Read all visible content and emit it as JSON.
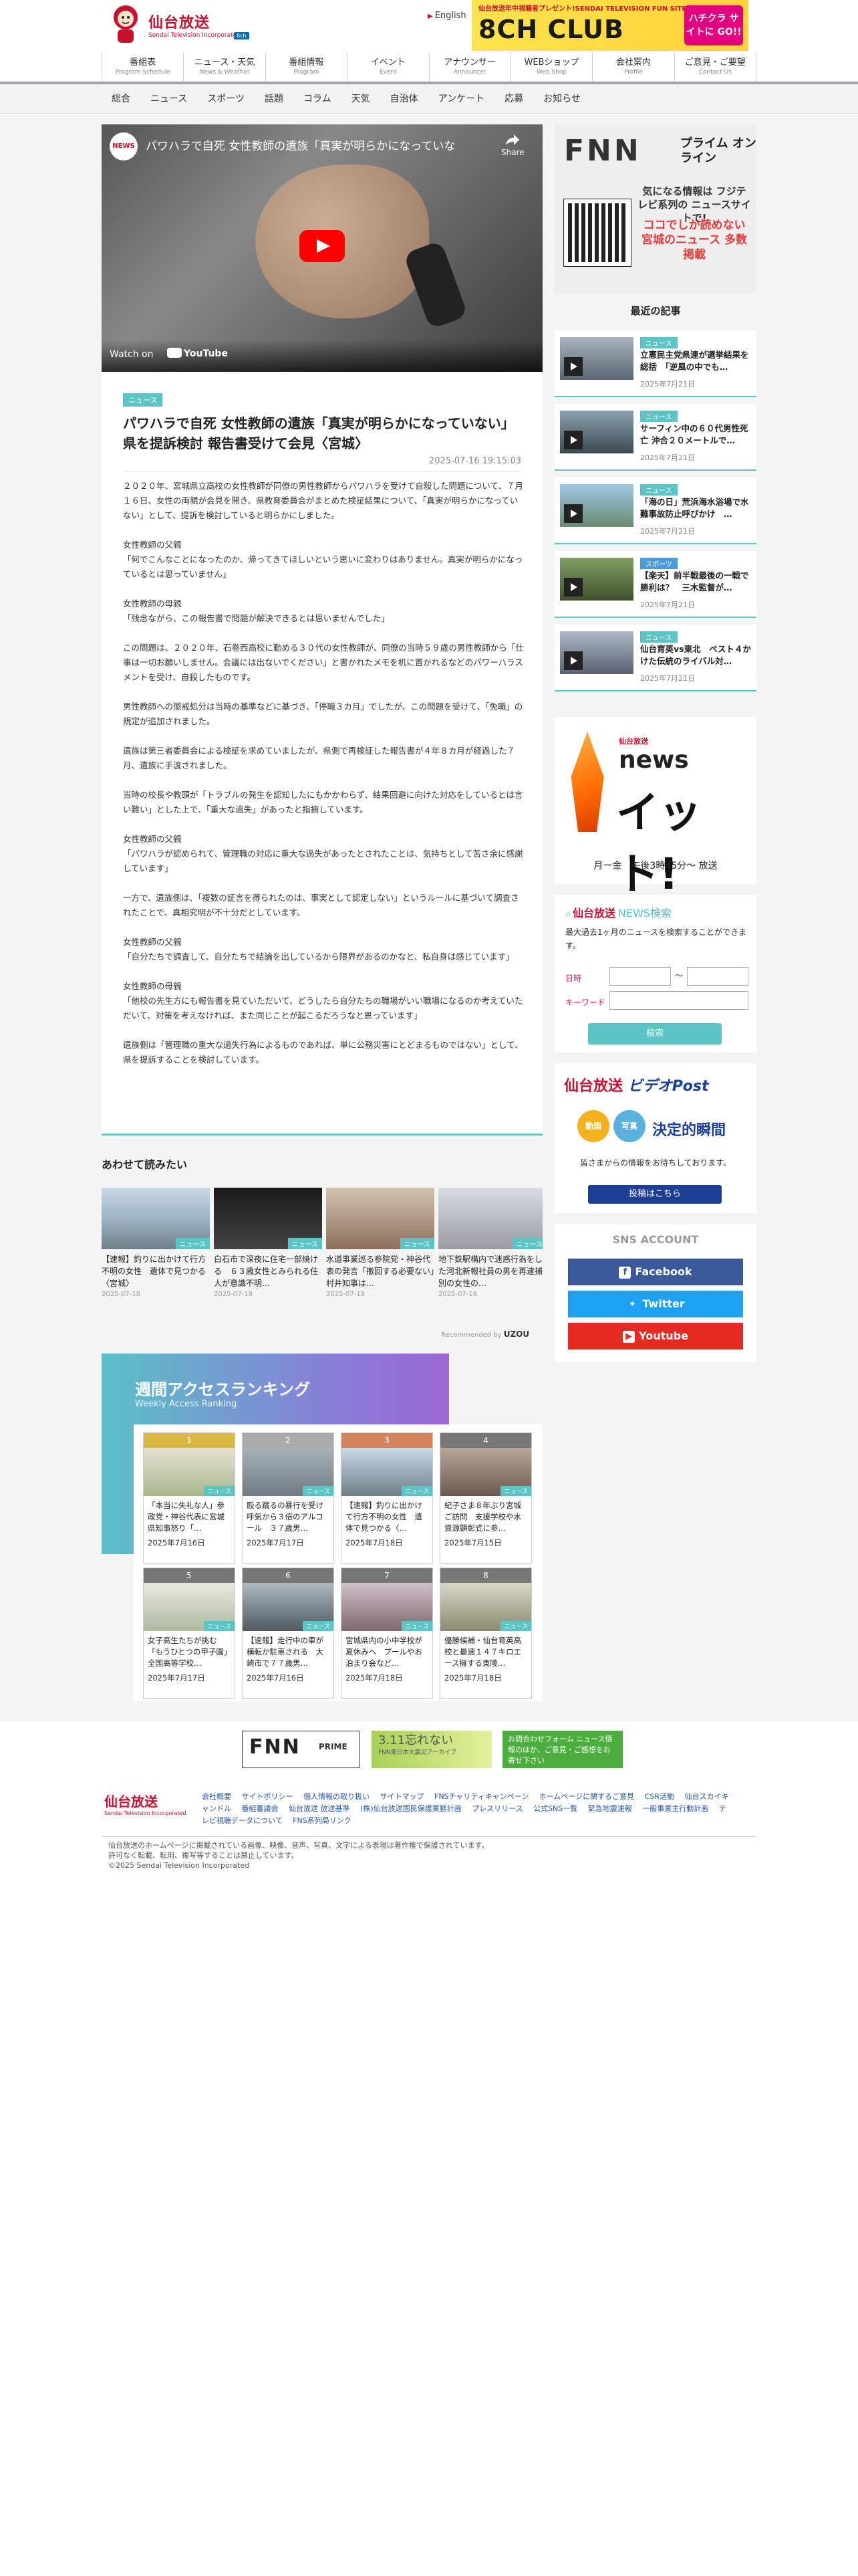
{
  "header": {
    "logo_text": "仙台放送",
    "logo_sub": "Sendai Television Incorporated",
    "logo_badge": "8ch",
    "lang": "English",
    "banner": {
      "top": "仙台放送年中視聴者プレゼント!SENDAI TELEVISION FUN SITE!",
      "main": "8CH CLUB",
      "side": "ハチクラ サイトに GO!!"
    }
  },
  "gnav": [
    {
      "jp": "番組表",
      "en": "Program Schedule"
    },
    {
      "jp": "ニュース・天気",
      "en": "News & Weather"
    },
    {
      "jp": "番組情報",
      "en": "Program"
    },
    {
      "jp": "イベント",
      "en": "Event"
    },
    {
      "jp": "アナウンサー",
      "en": "Announcer"
    },
    {
      "jp": "WEBショップ",
      "en": "Web Shop"
    },
    {
      "jp": "会社案内",
      "en": "Profile"
    },
    {
      "jp": "ご意見・ご要望",
      "en": "Contact Us"
    }
  ],
  "subnav": [
    "総合",
    "ニュース",
    "スポーツ",
    "話題",
    "コラム",
    "天気",
    "自治体",
    "アンケート",
    "応募",
    "お知らせ"
  ],
  "video": {
    "channel": "NEWS",
    "title": "パワハラで自死 女性教師の遺族「真実が明らかになっていな",
    "share": "Share",
    "watch_on": "Watch on",
    "youtube": "YouTube"
  },
  "article": {
    "tag": "ニュース",
    "title": "パワハラで自死 女性教師の遺族「真実が明らかになっていない」県を提訴検討 報告書受けて会見〈宮城〉",
    "date": "2025-07-16 19:15:03",
    "paragraphs": [
      "２０２０年、宮城県立高校の女性教師が同僚の男性教師からパワハラを受けて自殺した問題について、７月１６日、女性の両親が会見を開き、県教育委員会がまとめた検証結果について、「真実が明らかになっていない」として、提訴を検討していると明らかにしました。",
      "女性教師の父親\n「何でこんなことになったのか、帰ってきてほしいという思いに変わりはありません。真実が明らかになっているとは思っていません」",
      "女性教師の母親\n「残念ながら、この報告書で問題が解決できるとは思いませんでした」",
      "この問題は、２０２０年、石巻西高校に勤める３０代の女性教師が、同僚の当時５９歳の男性教師から「仕事は一切お願いしません。会議には出ないでください」と書かれたメモを机に置かれるなどのパワーハラスメントを受け、自殺したものです。",
      "男性教師への懲戒処分は当時の基準などに基づき、「停職３カ月」でしたが、この問題を受けて、「免職」の規定が追加されました。",
      "遺族は第三者委員会による検証を求めていましたが、県側で再検証した報告書が４年８カ月が経過した７月、遺族に手渡されました。",
      "当時の校長や教頭が「トラブルの発生を認知したにもかかわらず、結果回避に向けた対応をしているとは言い難い」とした上で、「重大な過失」があったと指摘しています。",
      "女性教師の父親\n「パワハラが認められて、管理職の対応に重大な過失があったとされたことは、気持ちとして苦さ余に感謝しています」",
      "一方で、遺族側は、「複数の証言を得られたのは、事実として認定しない」というルールに基づいて調査されたことで、真相究明が不十分だとしています。",
      "女性教師の父親\n「自分たちで調査して、自分たちで結論を出しているから限界があるのかなと、私自身は感じています」",
      "女性教師の母親\n「他校の先生方にも報告書を見ていただいて、どうしたら自分たちの職場がいい職場になるのか考えていただいて、対策を考えなければ、また同じことが起こるだろうなと思っています」",
      "遺族側は「管理職の重大な過失行為によるものであれば、単に公務災害にとどまるものではない」として、県を提訴することを検討しています。"
    ]
  },
  "related": {
    "heading": "あわせて読みたい",
    "tag": "ニュース",
    "items": [
      {
        "title": "【速報】釣りに出かけて行方不明の女性　遺体で見つかる〈宮城〉",
        "date": "2025-07-18"
      },
      {
        "title": "白石市で深夜に住宅一部焼ける　６３歳女性とみられる住人が意識不明…",
        "date": "2025-07-18"
      },
      {
        "title": "水道事業巡る参院党・神谷代表の発言「撤回する必要ない」村井知事は…",
        "date": "2025-07-18"
      },
      {
        "title": "地下鉄駅構内で迷惑行為をした河北新報社員の男を再逮捕　別の女性の…",
        "date": "2025-07-16"
      }
    ],
    "recommended": "Recommended by",
    "recommended_brand": "UZOU"
  },
  "ranking": {
    "title": "週間アクセスランキング",
    "subtitle": "Weekly Access Ranking",
    "tag": "ニュース",
    "items": [
      {
        "no": "1",
        "title": "「本当に失礼な人」参政党・神谷代表に宮城県知事怒り「…",
        "date": "2025年7月16日"
      },
      {
        "no": "2",
        "title": "殴る蹴るの暴行を受け　呼気から３倍のアルコール　３７歳男…",
        "date": "2025年7月17日"
      },
      {
        "no": "3",
        "title": "【速報】釣りに出かけて行方不明の女性　遺体で見つかる〈…",
        "date": "2025年7月18日"
      },
      {
        "no": "4",
        "title": "紀子さま８年ぶり宮城ご訪問　支援学校や水資源顕彰式に参…",
        "date": "2025年7月15日"
      },
      {
        "no": "5",
        "title": "女子高生たちが挑む「もうひとつの甲子園」全国高等学校…",
        "date": "2025年7月17日"
      },
      {
        "no": "6",
        "title": "【速報】走行中の車が横転か駐車される　大崎市で７７歳男…",
        "date": "2025年7月16日"
      },
      {
        "no": "7",
        "title": "宮城県内の小中学校が夏休みへ　プールやお泊まり会など…",
        "date": "2025年7月18日"
      },
      {
        "no": "8",
        "title": "優勝候補・仙台育英高校と最速１４７キロエース擁する東陵…",
        "date": "2025年7月18日"
      }
    ]
  },
  "sidebar": {
    "fnn": {
      "logo": "FNN",
      "prime": "プライム オンライン",
      "t1": "気になる情報は フジテレビ系列の ニュースサイトで!",
      "t2": "ココでしか読めない 宮城のニュース 多数掲載"
    },
    "latest_heading": "最近の記事",
    "news": [
      {
        "tag": "ニュース",
        "title": "立憲民主党県連が選挙結果を総括　「逆風の中でも…",
        "date": "2025年7月21日"
      },
      {
        "tag": "ニュース",
        "title": "サーフィン中の６０代男性死亡 沖合２０メートルで…",
        "date": "2025年7月21日"
      },
      {
        "tag": "ニュース",
        "title": "「海の日」荒浜海水浴場で水難事故防止呼びかけ　…",
        "date": "2025年7月21日"
      },
      {
        "tag": "スポーツ",
        "title": "【楽天】前半戦最後の一戦で勝利は？　三木監督が…",
        "date": "2025年7月21日"
      },
      {
        "tag": "ニュース",
        "title": "仙台育英vs東北　ベスト４かけた伝統のライバル対…",
        "date": "2025年7月21日"
      }
    ],
    "itto": {
      "small": "仙台放送",
      "news": "news",
      "main": "イット!",
      "time": "月ー金　午後3時45分～ 放送"
    },
    "search": {
      "title": "仙台放送",
      "title2": "NEWS検索",
      "desc": "最大過去1ヶ月のニュースを検索することができます。",
      "date_label": "日時",
      "tilde": "〜",
      "keyword_label": "キーワード",
      "button": "検索"
    },
    "vpost": {
      "logo": "仙台放送",
      "logo2": "ビデオPost",
      "c1": "動画",
      "c2": "写真",
      "tagline": "決定的瞬間",
      "desc": "皆さまからの情報をお待ちしております。",
      "button": "投稿はこちら"
    },
    "sns": {
      "title": "SNS ACCOUNT",
      "facebook": "Facebook",
      "twitter": "Twitter",
      "youtube": "Youtube"
    }
  },
  "footer_banners": {
    "fnn_prime": "FNN",
    "fnn_prime_sub": "PRIME",
    "archive": "3.11忘れない",
    "archive_sub": "FNN東日本大震災アーカイブ",
    "form": "お問合わせフォーム ニュース情報のほか、ご意見・ご感想をお寄せ下さい"
  },
  "footer": {
    "logo": "仙台放送",
    "logo_sub": "Sendai Television Incorporated",
    "links": [
      "会社概要",
      "サイトポリシー",
      "個人情報の取り扱い",
      "サイトマップ",
      "FNSチャリティキャンペーン",
      "ホームページに関するご意見",
      "CSR活動",
      "仙台スカイキャンドル",
      "番組審議会",
      "仙台放送 放送基準",
      "(株)仙台放送国民保護業務計画",
      "プレスリリース",
      "公式SNS一覧",
      "緊急地震速報",
      "一般事業主行動計画",
      "テレビ視聴データについて",
      "FNS系列局リンク"
    ],
    "copy1": "仙台放送のホームページに掲載されている画像、映像、音声、写真、文字による表現は著作権で保護されています。",
    "copy2": "許可なく転載、転用、複写等することは禁止しています。",
    "copy3": "©2025 Sendai Television Incorporated"
  }
}
